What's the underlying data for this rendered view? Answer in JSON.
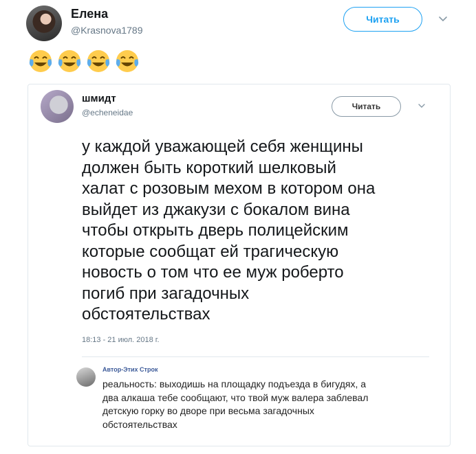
{
  "tweet": {
    "user_name": "Елена",
    "user_handle": "@Krasnova1789",
    "follow_label": "Читать",
    "emoji_count_glyphs": [
      "joy-emoji",
      "joy-emoji",
      "joy-emoji",
      "joy-emoji"
    ]
  },
  "quoted": {
    "user_name": "шмидт",
    "user_handle": "@echeneidae",
    "follow_label": "Читать",
    "text": "у каждой уважающей себя женщины\nдолжен быть короткий шелковый\nхалат с розовым мехом в котором она\nвыйдет из джакузи с бокалом вина\nчтобы открыть дверь полицейским\nкоторые сообщат ей трагическую\nновость о том что ее муж роберто\nпогиб при загадочных\nобстоятельствах",
    "timestamp": "18:13 - 21 июл. 2018 г."
  },
  "reply": {
    "author": "Автор-Этих Строк",
    "text": "реальность: выходишь на площадку подъезда в бигудях, а\nдва алкаша тебе сообщают, что твой муж валера заблевал\nдетскую горку во дворе при весьма загадочных\nобстоятельствах"
  },
  "colors": {
    "accent": "#1da1f2",
    "secondary_text": "#657786",
    "emoji_face": "#ffcc4d",
    "emoji_tears": "#5dadec"
  }
}
